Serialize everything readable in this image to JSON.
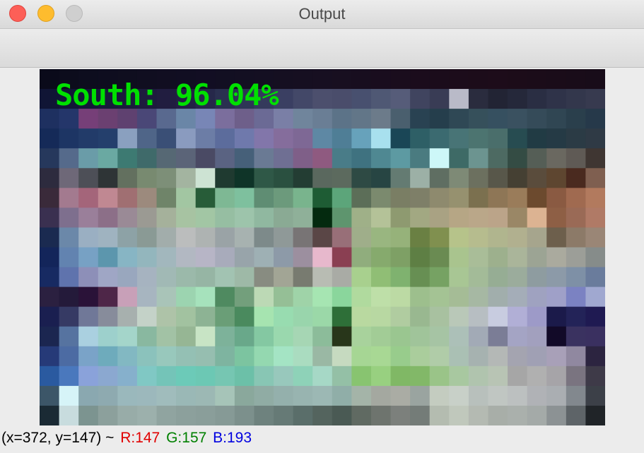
{
  "window": {
    "title": "Output"
  },
  "colors": {
    "overlay_text": "#00e000",
    "r": "#e00000",
    "g": "#008000",
    "b": "#0000e0"
  },
  "image": {
    "overlay_text": "South: 96.04%",
    "grid_cols": 29,
    "grid_rows": 18,
    "pixels": [
      [
        "#0a0a1a",
        "#0c0c1c",
        "#0d0d1e",
        "#0e0d1f",
        "#0f0e1f",
        "#100e20",
        "#110e21",
        "#110e22",
        "#120e23",
        "#120f22",
        "#130f22",
        "#140f22",
        "#150f21",
        "#160f21",
        "#170f21",
        "#180f20",
        "#180e1f",
        "#190d1e",
        "#1a0d1d",
        "#1b0c1c",
        "#1b0c1b",
        "#1c0c1b",
        "#1c0c1a",
        "#1d0c1a",
        "#1c0c19",
        "#1b0c19",
        "#1a0c19",
        "#190c19",
        "#180c19"
      ],
      [
        "#101535",
        "#121737",
        "#151838",
        "#181a3a",
        "#1b1b3c",
        "#1e1c3e",
        "#211d40",
        "#232045",
        "#26284a",
        "#2a3050",
        "#2e3556",
        "#343a5c",
        "#3a3f62",
        "#434868",
        "#4c4f6d",
        "#4a4d6b",
        "#48506f",
        "#4f5874",
        "#565c79",
        "#40445f",
        "#393c55",
        "#b9bac8",
        "#2a2c3e",
        "#222434",
        "#25283a",
        "#2a2e43",
        "#2f3349",
        "#33374c",
        "#373a4f"
      ],
      [
        "#1e3060",
        "#24366a",
        "#763f78",
        "#6b4071",
        "#5f4170",
        "#4a4777",
        "#59698f",
        "#6a86a7",
        "#7886b6",
        "#7b6e9d",
        "#6e5f8a",
        "#6b6a95",
        "#7a7fa6",
        "#70859c",
        "#6a7e95",
        "#5c7388",
        "#627688",
        "#6c7b8a",
        "#4a5f6e",
        "#294252",
        "#253e4c",
        "#2f4855",
        "#36505b",
        "#365060",
        "#3a5160",
        "#354b59",
        "#304653",
        "#2a3f4c",
        "#26394a"
      ],
      [
        "#152a58",
        "#1d3564",
        "#223b69",
        "#243f6c",
        "#8aa0bf",
        "#4f6588",
        "#3a4f76",
        "#8a9bbf",
        "#6c7da6",
        "#5c6c9c",
        "#6f79ac",
        "#8276aa",
        "#856d9c",
        "#7e6895",
        "#5e88a4",
        "#4f7e96",
        "#67a2bb",
        "#a8e0ee",
        "#1a4656",
        "#2e5f66",
        "#3b6a70",
        "#487476",
        "#4c7470",
        "#4a6e6b",
        "#274c51",
        "#213b44",
        "#253a45",
        "#2b3b45",
        "#2f3a45"
      ],
      [
        "#26385c",
        "#556a8b",
        "#6a9ca8",
        "#6aa9a2",
        "#3d7a72",
        "#3f6a6a",
        "#566874",
        "#5b6478",
        "#4a4a64",
        "#5a6382",
        "#466079",
        "#6a7a94",
        "#6f6f93",
        "#7f5f88",
        "#8f5a80",
        "#497c88",
        "#3f7280",
        "#4f8892",
        "#5d9aa2",
        "#4a7b80",
        "#cdf7f8",
        "#3e6a66",
        "#6c9490",
        "#4d6a62",
        "#344c44",
        "#555e56",
        "#6a6860",
        "#5f5a55",
        "#3f3632"
      ],
      [
        "#2d2b3e",
        "#6e6878",
        "#4d4f57",
        "#2e3436",
        "#63705f",
        "#788a70",
        "#7d8f78",
        "#a3b4a0",
        "#cde3d3",
        "#1f3a30",
        "#0f3428",
        "#2f5847",
        "#2a5040",
        "#233d33",
        "#5a685e",
        "#5c6a5e",
        "#2e4a44",
        "#274543",
        "#647b72",
        "#9cb0a6",
        "#5f6e62",
        "#7e8a76",
        "#6c705f",
        "#58574a",
        "#454033",
        "#5a4c3c",
        "#5e4630",
        "#4a2a1f",
        "#7f5f50"
      ],
      [
        "#3a2a3a",
        "#a37a8f",
        "#a4657a",
        "#c08892",
        "#a06f72",
        "#9c8a7d",
        "#6f8469",
        "#a2c6a2",
        "#275c38",
        "#7eb894",
        "#7ec09e",
        "#5f8d73",
        "#6c9a7c",
        "#79b48d",
        "#1e5c34",
        "#5ca57a",
        "#5c6e58",
        "#7b8a6e",
        "#7a7e64",
        "#7e7f68",
        "#8e8a6e",
        "#96916f",
        "#7b704f",
        "#8e7656",
        "#9a7c5a",
        "#6c4a2e",
        "#8a5a42",
        "#a06a50",
        "#b27a5e"
      ],
      [
        "#3a3050",
        "#7e6f8e",
        "#9a7f9a",
        "#8c6f88",
        "#9a8a96",
        "#9b9a93",
        "#a5b19b",
        "#a7c3a2",
        "#a2c6a4",
        "#96bea2",
        "#9dc4ab",
        "#90b8a0",
        "#8aaa94",
        "#8fb099",
        "#042a0f",
        "#5e956e",
        "#9fb088",
        "#b4c298",
        "#8e9a70",
        "#a2a882",
        "#a9a283",
        "#b6a685",
        "#baa789",
        "#bba489",
        "#9a8766",
        "#dcb392",
        "#8e5f45",
        "#9a6a56",
        "#b07a66"
      ],
      [
        "#1a2a50",
        "#6b88a9",
        "#9aafc2",
        "#9fb3c0",
        "#8da2a6",
        "#8a9a95",
        "#a2adab",
        "#bbbdbd",
        "#aeb3b2",
        "#9aa3a6",
        "#a7b2b0",
        "#7d8a8a",
        "#8f9998",
        "#787475",
        "#5a4646",
        "#986f78",
        "#9fae8a",
        "#99b680",
        "#96b27a",
        "#6a8043",
        "#80904f",
        "#b6c38a",
        "#b6bc8e",
        "#b0b58e",
        "#b1b08f",
        "#a6a58d",
        "#6d5f4c",
        "#8c7a68",
        "#9a8676"
      ],
      [
        "#13255a",
        "#6283b0",
        "#77a1c4",
        "#5c96ad",
        "#87b5c4",
        "#93b6bd",
        "#a2b7bd",
        "#b2b8c2",
        "#b7b5c6",
        "#a8abbb",
        "#98a4aa",
        "#9eb0b4",
        "#8d9aa8",
        "#9c8f9f",
        "#e7b8cc",
        "#8a3f52",
        "#90ad7d",
        "#86aa6d",
        "#7ea065",
        "#5e7f44",
        "#6a8b52",
        "#a9c48e",
        "#a9bd98",
        "#9db08d",
        "#aab59a",
        "#9ca494",
        "#aaaa9e",
        "#9c9e98",
        "#868c8a"
      ],
      [
        "#172a62",
        "#5f73ad",
        "#8d8fb8",
        "#9fa6c5",
        "#99a7be",
        "#a6b3c0",
        "#a1b9b5",
        "#9bb9aa",
        "#96b5a4",
        "#a2c3b2",
        "#9eb9a7",
        "#888c81",
        "#a2a595",
        "#787b70",
        "#b8bcb3",
        "#a9aba5",
        "#a8d08e",
        "#90be75",
        "#7fb26f",
        "#678f53",
        "#76a263",
        "#a8c694",
        "#a3bb98",
        "#96ad94",
        "#9bac9c",
        "#8e9ca0",
        "#8c9aa8",
        "#7e90a6",
        "#6a7c9c"
      ],
      [
        "#2b2040",
        "#241a3a",
        "#2a1238",
        "#4e2648",
        "#c8a0b8",
        "#a7b5c0",
        "#a9c4b8",
        "#9cd4b0",
        "#a6e2bc",
        "#4f8a60",
        "#739f7c",
        "#bcd9b5",
        "#95bf96",
        "#9fd3a8",
        "#a6e5b2",
        "#8ad69c",
        "#b0da9e",
        "#bedfa8",
        "#bcdaa4",
        "#9dbf8d",
        "#a4c394",
        "#a5bc96",
        "#a6b8a3",
        "#a1aeac",
        "#a4adb8",
        "#9fa2c0",
        "#9fa0c8",
        "#7b82c2",
        "#a0a8d0"
      ],
      [
        "#1a1f50",
        "#363a64",
        "#707898",
        "#878c9b",
        "#a7b0ae",
        "#c4d2c8",
        "#aec3a8",
        "#a2c2a0",
        "#8db394",
        "#6a9e77",
        "#4a8a5e",
        "#a6e4b0",
        "#98dcb0",
        "#99d5ac",
        "#9bd8a8",
        "#2e6f38",
        "#b9d9a0",
        "#b8d8a2",
        "#b0cca0",
        "#99b890",
        "#a8c1a0",
        "#b9c8b8",
        "#b7bec2",
        "#c8cce0",
        "#b1afd6",
        "#9d9ac8",
        "#1b1a4a",
        "#232358",
        "#1f1a52"
      ],
      [
        "#1b2650",
        "#5673a0",
        "#aad0e0",
        "#9dd0cc",
        "#a4d5ca",
        "#89b8a0",
        "#a2c2a5",
        "#96b694",
        "#c8e4c5",
        "#7db29a",
        "#69a88a",
        "#84c8a2",
        "#9ad8ae",
        "#a6d6b4",
        "#8cbc9a",
        "#28361a",
        "#a8d29c",
        "#a2cc96",
        "#9ac690",
        "#a0c49a",
        "#a6c4a4",
        "#acc0b8",
        "#a2aab6",
        "#7b7d96",
        "#a4a4c4",
        "#a2a0be",
        "#120a28",
        "#3a3260",
        "#3a3060"
      ],
      [
        "#263a78",
        "#4c6ba3",
        "#7aa3c8",
        "#6eabbc",
        "#82b8c2",
        "#8bc2bc",
        "#98c8bc",
        "#94c0b4",
        "#96beb0",
        "#7eb4a0",
        "#7cc4a0",
        "#94d8b0",
        "#a4e4c4",
        "#aadcc0",
        "#9ab8a4",
        "#c6dac0",
        "#a6d694",
        "#a8d894",
        "#98cc8c",
        "#aacd9c",
        "#b0cca8",
        "#aac0b4",
        "#a6b2b0",
        "#b4b8b6",
        "#a4a4b0",
        "#a0a0b4",
        "#a8a0b8",
        "#9088a0",
        "#2c2440"
      ],
      [
        "#2a5aa0",
        "#4a78bd",
        "#8aa2da",
        "#8ba8d0",
        "#86b0cc",
        "#80c8c4",
        "#74c4b8",
        "#6ccab8",
        "#6cc8b4",
        "#76c6b2",
        "#6cc0a8",
        "#88c6b4",
        "#98c8bc",
        "#8ed2b8",
        "#a6d8c6",
        "#94c0a6",
        "#88c470",
        "#98d080",
        "#80b865",
        "#82b868",
        "#9ac488",
        "#a8c8a0",
        "#b0c4ae",
        "#b8c4b4",
        "#a6a6a6",
        "#b0b0b0",
        "#a6a4a8",
        "#7a7480",
        "#3e3a48"
      ],
      [
        "#3c5668",
        "#d6f4f8",
        "#8aa8b0",
        "#8eaab0",
        "#9ab8bc",
        "#9cb8bc",
        "#a0bcbc",
        "#9ab8b6",
        "#9cb8b4",
        "#a6c4b8",
        "#8aa89c",
        "#90aca4",
        "#94b0ac",
        "#98b4b0",
        "#9cb8b4",
        "#90aea8",
        "#a4b4a8",
        "#a4a8a0",
        "#aaaca4",
        "#9aa4a0",
        "#c4ccc0",
        "#c8d0c8",
        "#b8c0bc",
        "#c0c6c2",
        "#bcc0c0",
        "#b0b2b6",
        "#aaaeb2",
        "#82888e",
        "#3c4048"
      ],
      [
        "#1a2a34",
        "#c8dcde",
        "#7c9490",
        "#8ca09c",
        "#98aca8",
        "#9cb0ac",
        "#90a4a0",
        "#8ca09c",
        "#8a9e9a",
        "#869a96",
        "#7c908c",
        "#6e827e",
        "#667a76",
        "#5a6e6a",
        "#54645e",
        "#4a5a54",
        "#606a62",
        "#6e746e",
        "#7c807c",
        "#747c78",
        "#b4bcb0",
        "#c0c8bc",
        "#b4bab2",
        "#a8aea8",
        "#aab0ac",
        "#a4aaa8",
        "#8c9294",
        "#5e6468",
        "#202428"
      ]
    ]
  },
  "status": {
    "coords": "(x=372, y=147) ~",
    "r": "R:147",
    "g": "G:157",
    "b": "B:193"
  }
}
